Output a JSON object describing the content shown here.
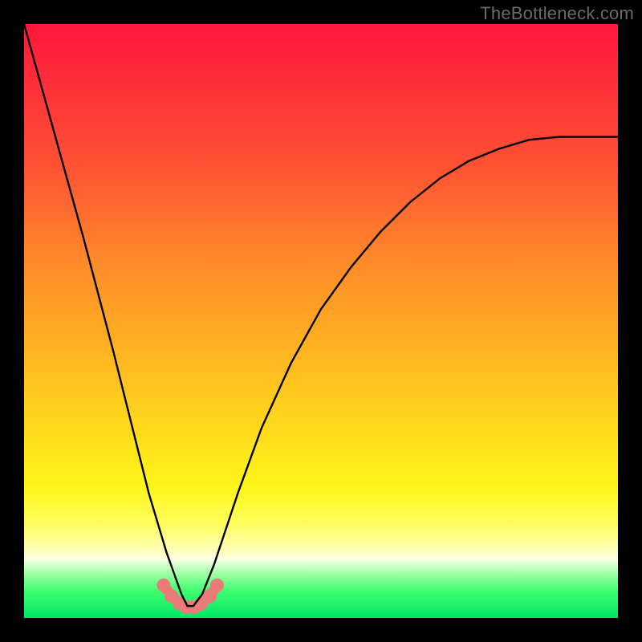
{
  "watermark": "TheBottleneck.com",
  "chart_data": {
    "type": "line",
    "title": "",
    "xlabel": "",
    "ylabel": "",
    "xlim": [
      0,
      100
    ],
    "ylim": [
      0,
      100
    ],
    "series": [
      {
        "name": "bottleneck-curve",
        "x": [
          0,
          5,
          10,
          15,
          18,
          21,
          24,
          26.5,
          27.5,
          28.5,
          30,
          32,
          34,
          36,
          40,
          45,
          50,
          55,
          60,
          65,
          70,
          75,
          80,
          85,
          90,
          95,
          100
        ],
        "values": [
          100,
          82,
          64,
          45,
          33,
          21,
          11,
          4,
          2,
          2,
          4,
          9,
          15,
          21,
          32,
          43,
          52,
          59,
          65,
          70,
          74,
          77,
          79,
          80.5,
          81,
          81,
          81
        ]
      },
      {
        "name": "highlight-markers",
        "x": [
          23.5,
          24.8,
          26.2,
          27.4,
          28.6,
          29.8,
          31.3,
          32.5
        ],
        "values": [
          5.5,
          3.7,
          2.4,
          1.8,
          1.8,
          2.4,
          3.7,
          5.5
        ]
      }
    ],
    "marker_color": "#ec7a76",
    "curve_color": "#000000"
  }
}
